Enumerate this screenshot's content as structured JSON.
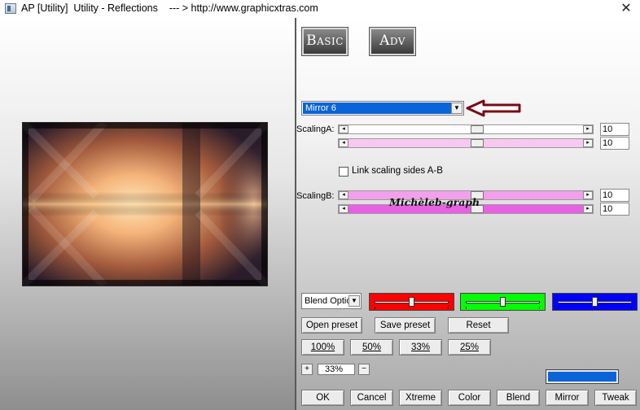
{
  "window": {
    "title": "AP [Utility]  Utility - Reflections    --- > http://www.graphicxtras.com",
    "close_glyph": "✕"
  },
  "mode_buttons": {
    "basic": "Basic",
    "adv": "Adv"
  },
  "preset_dropdown": {
    "selected": "Mirror 6",
    "arrow": "▼"
  },
  "scaling_a": {
    "label": "ScalingA:",
    "sliders": [
      {
        "value": "10",
        "level": 0.55
      },
      {
        "value": "10",
        "level": 0.55
      }
    ],
    "colors": [
      "#ffffff",
      "#f7c8f0"
    ]
  },
  "link_scaling": {
    "label": "Link scaling sides A-B",
    "checked": false
  },
  "scaling_b": {
    "label": "ScalingB:",
    "sliders": [
      {
        "value": "10",
        "level": 0.55
      },
      {
        "value": "10",
        "level": 0.55
      }
    ],
    "colors": [
      "#f2a0ec",
      "#e860e4"
    ]
  },
  "watermark": "Michèleb-graph",
  "blend": {
    "select_value": "Blend Optio",
    "channels": [
      {
        "color": "#ff0000",
        "level": 0.5
      },
      {
        "color": "#00ff00",
        "level": 0.5
      },
      {
        "color": "#0000ff",
        "level": 0.5
      }
    ]
  },
  "preset_buttons": {
    "open": "Open preset",
    "save": "Save preset",
    "reset": "Reset"
  },
  "zoom_buttons": [
    "100%",
    "50%",
    "33%",
    "25%"
  ],
  "zoom_spin": {
    "plus": "+",
    "value": "33%",
    "minus": "−"
  },
  "color_swatch": "#0a64d8",
  "bottom_buttons": [
    "OK",
    "Cancel",
    "Xtreme",
    "Color",
    "Blend",
    "Mirror",
    "Tweak"
  ],
  "scroll_glyphs": {
    "left": "◂",
    "right": "▸"
  }
}
